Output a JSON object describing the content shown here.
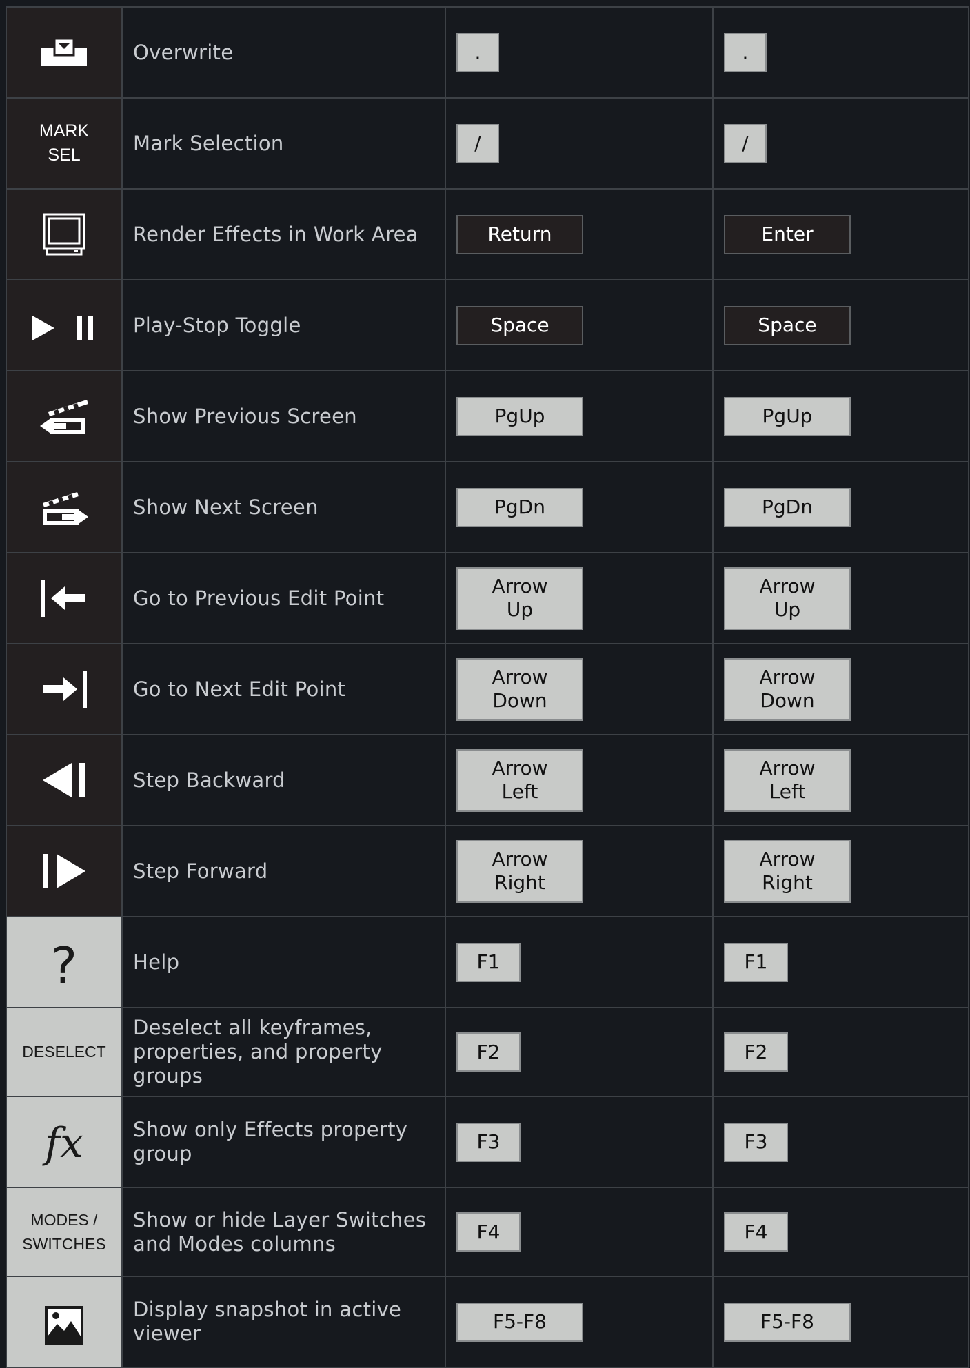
{
  "rows": [
    {
      "icon": "overwrite-icon",
      "description": "Overwrite",
      "key1": ".",
      "key2": "."
    },
    {
      "icon_text": "MARK\nSEL",
      "description": "Mark Selection",
      "key1": "/",
      "key2": "/"
    },
    {
      "icon": "monitor-icon",
      "description": "Render Effects in Work Area",
      "key1": "Return",
      "key2": "Enter"
    },
    {
      "icon": "play-pause-icon",
      "description": "Play-Stop Toggle",
      "key1": "Space",
      "key2": "Space"
    },
    {
      "icon": "clapper-left-icon",
      "description": "Show Previous Screen",
      "key1": "PgUp",
      "key2": "PgUp"
    },
    {
      "icon": "clapper-right-icon",
      "description": "Show Next Screen",
      "key1": "PgDn",
      "key2": "PgDn"
    },
    {
      "icon": "previous-edit-point-icon",
      "description": "Go to Previous Edit Point",
      "key1": "Arrow\nUp",
      "key2": "Arrow\nUp"
    },
    {
      "icon": "next-edit-point-icon",
      "description": "Go to Next Edit Point",
      "key1": "Arrow\nDown",
      "key2": "Arrow\nDown"
    },
    {
      "icon": "step-backward-icon",
      "description": "Step Backward",
      "key1": "Arrow\nLeft",
      "key2": "Arrow\nLeft"
    },
    {
      "icon": "step-forward-icon",
      "description": "Step Forward",
      "key1": "Arrow\nRight",
      "key2": "Arrow\nRight"
    },
    {
      "icon_text": "?",
      "description": "Help",
      "key1": "F1",
      "key2": "F1"
    },
    {
      "icon_text": "DESELECT",
      "description": "Deselect all keyframes, properties, and property groups",
      "key1": "F2",
      "key2": "F2"
    },
    {
      "icon_text": "fx",
      "description": "Show only Effects property group",
      "key1": "F3",
      "key2": "F3"
    },
    {
      "icon_text": "MODES /\nSWITCHES",
      "description": "Show or hide Layer Switches and Modes columns",
      "key1": "F4",
      "key2": "F4"
    },
    {
      "icon": "snapshot-image-icon",
      "description": "Display snapshot in active viewer",
      "key1": "F5-F8",
      "key2": "F5-F8"
    }
  ],
  "colors": {
    "background": "#16191e",
    "dark_icon_cell": "#231f20",
    "light_icon_cell": "#c8cac8",
    "key_light": "#c8cac8",
    "grid_line": "#3d4146"
  }
}
